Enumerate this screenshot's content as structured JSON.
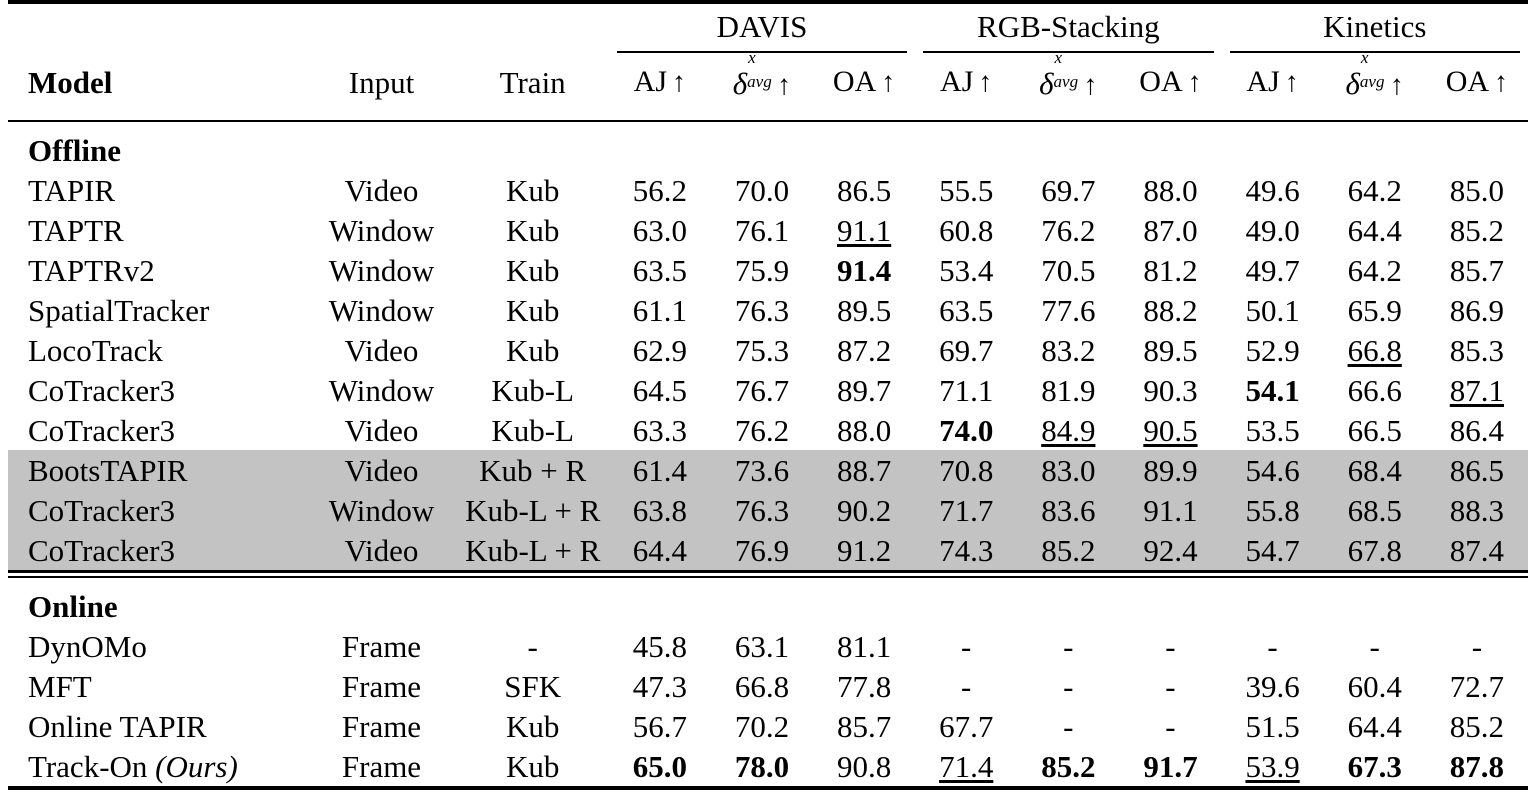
{
  "table": {
    "column_headers": {
      "model": "Model",
      "input": "Input",
      "train": "Train"
    },
    "benchmark_groups": [
      {
        "name": "DAVIS"
      },
      {
        "name": "RGB-Stacking"
      },
      {
        "name": "Kinetics"
      }
    ],
    "metrics": [
      {
        "label": "AJ",
        "arrow": "↑"
      },
      {
        "label": "δ",
        "sup": "x",
        "sub": "avg",
        "arrow": "↑"
      },
      {
        "label": "OA",
        "arrow": "↑"
      }
    ],
    "metric_labels_flat": [
      "AJ ↑",
      "δᵡₐᵥᵍ ↑",
      "OA ↑"
    ],
    "sections": [
      {
        "title": "Offline",
        "rows": [
          {
            "model": "TAPIR",
            "input": "Video",
            "train": "Kub",
            "values": [
              "56.2",
              "70.0",
              "86.5",
              "55.5",
              "69.7",
              "88.0",
              "49.6",
              "64.2",
              "85.0"
            ],
            "styles": [
              "",
              "",
              "",
              "",
              "",
              "",
              "",
              "",
              ""
            ],
            "shaded": false
          },
          {
            "model": "TAPTR",
            "input": "Window",
            "train": "Kub",
            "values": [
              "63.0",
              "76.1",
              "91.1",
              "60.8",
              "76.2",
              "87.0",
              "49.0",
              "64.4",
              "85.2"
            ],
            "styles": [
              "",
              "",
              "u",
              "",
              "",
              "",
              "",
              "",
              ""
            ],
            "shaded": false
          },
          {
            "model": "TAPTRv2",
            "input": "Window",
            "train": "Kub",
            "values": [
              "63.5",
              "75.9",
              "91.4",
              "53.4",
              "70.5",
              "81.2",
              "49.7",
              "64.2",
              "85.7"
            ],
            "styles": [
              "",
              "",
              "b",
              "",
              "",
              "",
              "",
              "",
              ""
            ],
            "shaded": false
          },
          {
            "model": "SpatialTracker",
            "input": "Window",
            "train": "Kub",
            "values": [
              "61.1",
              "76.3",
              "89.5",
              "63.5",
              "77.6",
              "88.2",
              "50.1",
              "65.9",
              "86.9"
            ],
            "styles": [
              "",
              "",
              "",
              "",
              "",
              "",
              "",
              "",
              ""
            ],
            "shaded": false
          },
          {
            "model": "LocoTrack",
            "input": "Video",
            "train": "Kub",
            "values": [
              "62.9",
              "75.3",
              "87.2",
              "69.7",
              "83.2",
              "89.5",
              "52.9",
              "66.8",
              "85.3"
            ],
            "styles": [
              "",
              "",
              "",
              "",
              "",
              "",
              "",
              "u",
              ""
            ],
            "shaded": false
          },
          {
            "model": "CoTracker3",
            "input": "Window",
            "train": "Kub-L",
            "values": [
              "64.5",
              "76.7",
              "89.7",
              "71.1",
              "81.9",
              "90.3",
              "54.1",
              "66.6",
              "87.1"
            ],
            "styles": [
              "",
              "",
              "",
              "",
              "",
              "",
              "b",
              "",
              "u"
            ],
            "shaded": false
          },
          {
            "model": "CoTracker3",
            "input": "Video",
            "train": "Kub-L",
            "values": [
              "63.3",
              "76.2",
              "88.0",
              "74.0",
              "84.9",
              "90.5",
              "53.5",
              "66.5",
              "86.4"
            ],
            "styles": [
              "",
              "",
              "",
              "b",
              "u",
              "u",
              "",
              "",
              ""
            ],
            "shaded": false
          },
          {
            "model": "BootsTAPIR",
            "input": "Video",
            "train": "Kub + R",
            "values": [
              "61.4",
              "73.6",
              "88.7",
              "70.8",
              "83.0",
              "89.9",
              "54.6",
              "68.4",
              "86.5"
            ],
            "styles": [
              "",
              "",
              "",
              "",
              "",
              "",
              "",
              "",
              ""
            ],
            "shaded": true
          },
          {
            "model": "CoTracker3",
            "input": "Window",
            "train": "Kub-L + R",
            "values": [
              "63.8",
              "76.3",
              "90.2",
              "71.7",
              "83.6",
              "91.1",
              "55.8",
              "68.5",
              "88.3"
            ],
            "styles": [
              "",
              "",
              "",
              "",
              "",
              "",
              "",
              "",
              ""
            ],
            "shaded": true
          },
          {
            "model": "CoTracker3",
            "input": "Video",
            "train": "Kub-L + R",
            "values": [
              "64.4",
              "76.9",
              "91.2",
              "74.3",
              "85.2",
              "92.4",
              "54.7",
              "67.8",
              "87.4"
            ],
            "styles": [
              "",
              "",
              "",
              "",
              "",
              "",
              "",
              "",
              ""
            ],
            "shaded": true
          }
        ]
      },
      {
        "title": "Online",
        "rows": [
          {
            "model": "DynOMo",
            "input": "Frame",
            "train": "-",
            "values": [
              "45.8",
              "63.1",
              "81.1",
              "-",
              "-",
              "-",
              "-",
              "-",
              "-"
            ],
            "styles": [
              "",
              "",
              "",
              "",
              "",
              "",
              "",
              "",
              ""
            ],
            "shaded": false
          },
          {
            "model": "MFT",
            "input": "Frame",
            "train": "SFK",
            "values": [
              "47.3",
              "66.8",
              "77.8",
              "-",
              "-",
              "-",
              "39.6",
              "60.4",
              "72.7"
            ],
            "styles": [
              "",
              "",
              "",
              "",
              "",
              "",
              "",
              "",
              ""
            ],
            "shaded": false
          },
          {
            "model": "Online TAPIR",
            "input": "Frame",
            "train": "Kub",
            "values": [
              "56.7",
              "70.2",
              "85.7",
              "67.7",
              "-",
              "-",
              "51.5",
              "64.4",
              "85.2"
            ],
            "styles": [
              "",
              "",
              "",
              "",
              "",
              "",
              "",
              "",
              ""
            ],
            "shaded": false
          },
          {
            "model": "Track-On",
            "model_suffix": "(Ours)",
            "input": "Frame",
            "train": "Kub",
            "values": [
              "65.0",
              "78.0",
              "90.8",
              "71.4",
              "85.2",
              "91.7",
              "53.9",
              "67.3",
              "87.8"
            ],
            "styles": [
              "b",
              "b",
              "",
              "u",
              "b",
              "b",
              "u",
              "b",
              "b"
            ],
            "shaded": false
          }
        ]
      }
    ],
    "colors": {
      "shaded_row_background": "#c3c3c3",
      "rule": "#000000",
      "text": "#000000"
    }
  }
}
